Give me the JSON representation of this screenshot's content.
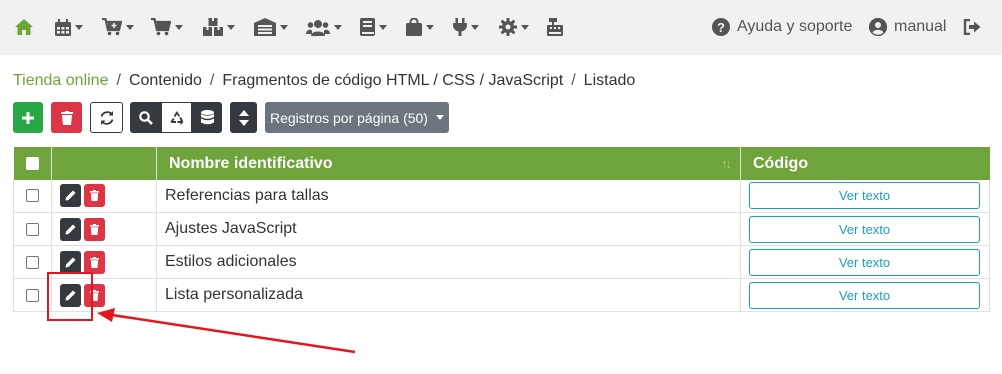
{
  "topnav": {
    "icons": [
      "home-icon",
      "calendar-icon",
      "cart-plus-icon",
      "cart-icon",
      "boxes-icon",
      "warehouse-icon",
      "users-icon",
      "book-icon",
      "shopping-bag-icon",
      "plug-icon",
      "gear-icon",
      "cash-register-icon"
    ],
    "help_label": "Ayuda y soporte",
    "user_label": "manual"
  },
  "breadcrumb": {
    "items": [
      "Tienda online",
      "Contenido",
      "Fragmentos de código HTML / CSS / JavaScript",
      "Listado"
    ],
    "separator": "/"
  },
  "toolbar": {
    "per_page_label": "Registros por página (50)"
  },
  "table": {
    "headers": [
      "Nombre identificativo",
      "Código"
    ],
    "rows": [
      {
        "name": "Referencias para tallas",
        "code_button": "Ver texto"
      },
      {
        "name": "Ajustes JavaScript",
        "code_button": "Ver texto"
      },
      {
        "name": "Estilos adicionales",
        "code_button": "Ver texto"
      },
      {
        "name": "Lista personalizada",
        "code_button": "Ver texto"
      }
    ]
  },
  "colors": {
    "brand_green": "#6ea43b",
    "danger": "#dc3545",
    "info": "#17a2b8",
    "annotation_red": "#e8141c"
  }
}
